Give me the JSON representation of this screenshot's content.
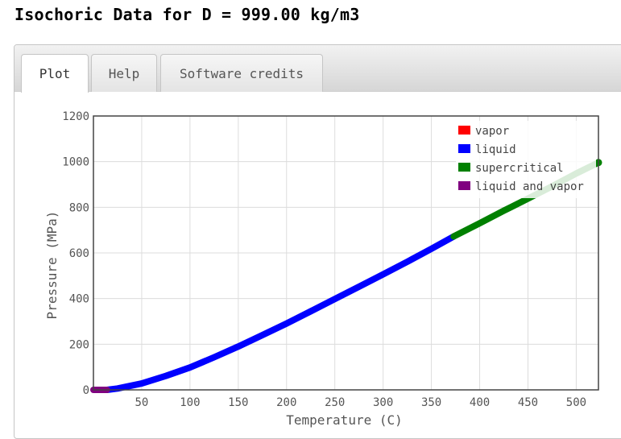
{
  "page": {
    "title": "Isochoric Data for D = 999.00 kg/m3"
  },
  "tabs": [
    {
      "label": "Plot",
      "active": true
    },
    {
      "label": "Help",
      "active": false
    },
    {
      "label": "Software credits",
      "active": false
    }
  ],
  "chart_data": {
    "type": "line",
    "xlabel": "Temperature (C)",
    "ylabel": "Pressure (MPa)",
    "xlim": [
      0,
      523
    ],
    "ylim": [
      0,
      1200
    ],
    "x_ticks": [
      50,
      100,
      150,
      200,
      250,
      300,
      350,
      400,
      450,
      500
    ],
    "y_ticks": [
      0,
      200,
      400,
      600,
      800,
      1000,
      1200
    ],
    "grid": true,
    "legend_position": "top-right",
    "series": [
      {
        "name": "vapor",
        "color": "#ff0000",
        "x": [],
        "y": []
      },
      {
        "name": "liquid",
        "color": "#0000ff",
        "x": [
          14,
          25,
          50,
          75,
          100,
          125,
          150,
          175,
          200,
          225,
          250,
          275,
          300,
          325,
          350,
          373
        ],
        "y": [
          0,
          6,
          28,
          61,
          98,
          143,
          190,
          240,
          291,
          344,
          398,
          452,
          506,
          561,
          618,
          672
        ]
      },
      {
        "name": "supercritical",
        "color": "#008000",
        "x": [
          373,
          400,
          425,
          450,
          475,
          500,
          523
        ],
        "y": [
          672,
          730,
          785,
          838,
          892,
          948,
          996
        ]
      },
      {
        "name": "liquid and vapor",
        "color": "#800080",
        "x": [
          0,
          5,
          10,
          14
        ],
        "y": [
          0,
          0,
          0,
          0
        ]
      }
    ]
  }
}
